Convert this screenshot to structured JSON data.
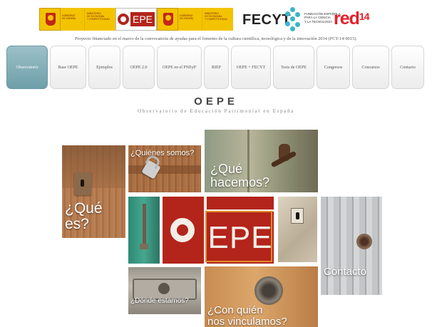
{
  "logos": {
    "gov_label": "GOBIERNO\nDE ESPAÑA",
    "ministry_label": "MINISTERIO\nDE ECONOMÍA\nY COMPETITIVIDAD",
    "oepe_mark": "EPE",
    "fecyt_label": "FECYT",
    "fecyt_subtitle": "FUNDACIÓN ESPAÑOLA\nPARA LA CIENCIA\nY LA TECNOLOGÍA",
    "red_label": "red",
    "red_number": "14"
  },
  "project_note": "Proyecto financiado en el marco de la convocatoria de ayudas para el fomento de la cultura científica, tecnológica y de la innovación 2014 (FCT-14-9015).",
  "nav": {
    "items": [
      {
        "label": "Observatorio",
        "active": true
      },
      {
        "label": "Base OEPE"
      },
      {
        "label": "Ejemplos"
      },
      {
        "label": "OEPE 2.0"
      },
      {
        "label": "OEPE en el PNEyP"
      },
      {
        "label": "RIEP"
      },
      {
        "label": "OEPE + FECYT"
      },
      {
        "label": "Tesis de OEPE"
      },
      {
        "label": "Congresos"
      },
      {
        "label": "Concursos"
      },
      {
        "label": "Contacto"
      }
    ]
  },
  "site": {
    "title": "OEPE",
    "subtitle": "Observatorio de Educación Patrimonial en España"
  },
  "mosaic": {
    "que_es": "¿Qué es?",
    "quienes_somos": "¿Quiénes somos?",
    "que_hacemos": "¿Qué\nhacemos?",
    "logo_epe": "EPE",
    "contacto": "Contacto",
    "donde_estamos": "¿Dónde estamos?",
    "con_quien": "¿Con quién\nnos vinculamos?"
  },
  "colors": {
    "brand_red": "#b3241b",
    "nav_active": "#7fa9b2",
    "fecyt_teal": "#39b6c9",
    "red_logo": "#e3212a",
    "gov_yellow": "#f3c300"
  }
}
